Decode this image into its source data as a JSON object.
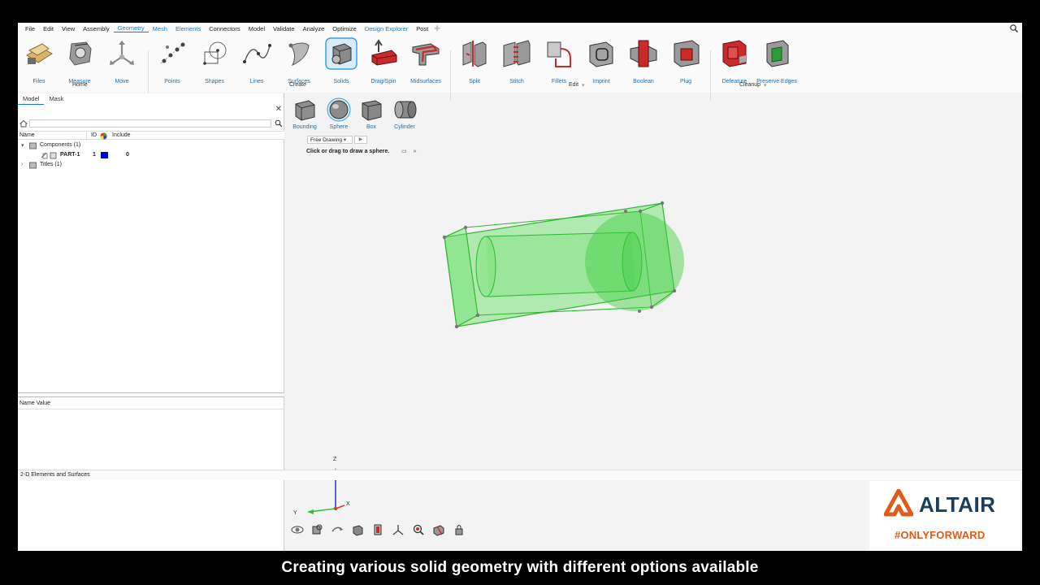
{
  "menu": {
    "items": [
      "File",
      "Edit",
      "View",
      "Assembly",
      "Geometry",
      "Mesh",
      "Elements",
      "Connectors",
      "Model",
      "Validate",
      "Analyze",
      "Optimize",
      "Design Explorer",
      "Post"
    ],
    "active": "Geometry"
  },
  "ribbon": {
    "tools": [
      {
        "label": "Files",
        "icon": "files-icon"
      },
      {
        "label": "Measure",
        "icon": "measure-icon"
      },
      {
        "label": "Move",
        "icon": "move-icon"
      },
      {
        "label": "Points",
        "icon": "points-icon"
      },
      {
        "label": "Shapes",
        "icon": "shapes-icon"
      },
      {
        "label": "Lines",
        "icon": "lines-icon"
      },
      {
        "label": "Surfaces",
        "icon": "surfaces-icon"
      },
      {
        "label": "Solids",
        "icon": "solids-icon"
      },
      {
        "label": "Drag/Spin",
        "icon": "drag-spin-icon"
      },
      {
        "label": "Midsurfaces",
        "icon": "midsurfaces-icon"
      },
      {
        "label": "Split",
        "icon": "split-icon"
      },
      {
        "label": "Stitch",
        "icon": "stitch-icon"
      },
      {
        "label": "Fillets",
        "icon": "fillets-icon"
      },
      {
        "label": "Imprint",
        "icon": "imprint-icon"
      },
      {
        "label": "Boolean",
        "icon": "boolean-icon"
      },
      {
        "label": "Plug",
        "icon": "plug-icon"
      },
      {
        "label": "Defeature",
        "icon": "defeature-icon"
      },
      {
        "label": "Preserve Edges",
        "icon": "preserve-edges-icon"
      }
    ],
    "groups": [
      "Home",
      "Create",
      "Edit",
      "Cleanup"
    ]
  },
  "subtools": {
    "items": [
      "Bounding",
      "Sphere",
      "Box",
      "Cylinder"
    ],
    "active": "Sphere",
    "mode": "Free Drawing",
    "hint": "Click or drag to draw a sphere."
  },
  "browser": {
    "tabs": [
      "Model",
      "Mask"
    ],
    "columns": {
      "name": "Name",
      "id": "ID",
      "include": "Include"
    },
    "tree": {
      "components": "Components (1)",
      "part_name": "PART-1",
      "part_id": "1",
      "part_color": "#0000cc",
      "part_include": "0",
      "titles": "Titles (1)"
    },
    "properties_header": "Name Value"
  },
  "status_bar": "2-D Elements and Surfaces",
  "viewport": {
    "geometry_color": "#4fd84f",
    "axes": {
      "z": "Z",
      "y": "Y",
      "x": "X"
    }
  },
  "logo": {
    "word": "ALTAIR",
    "tagline": "#ONLYFORWARD",
    "brand_orange": "#e05a1b"
  },
  "caption": "Creating various solid geometry with different options available"
}
